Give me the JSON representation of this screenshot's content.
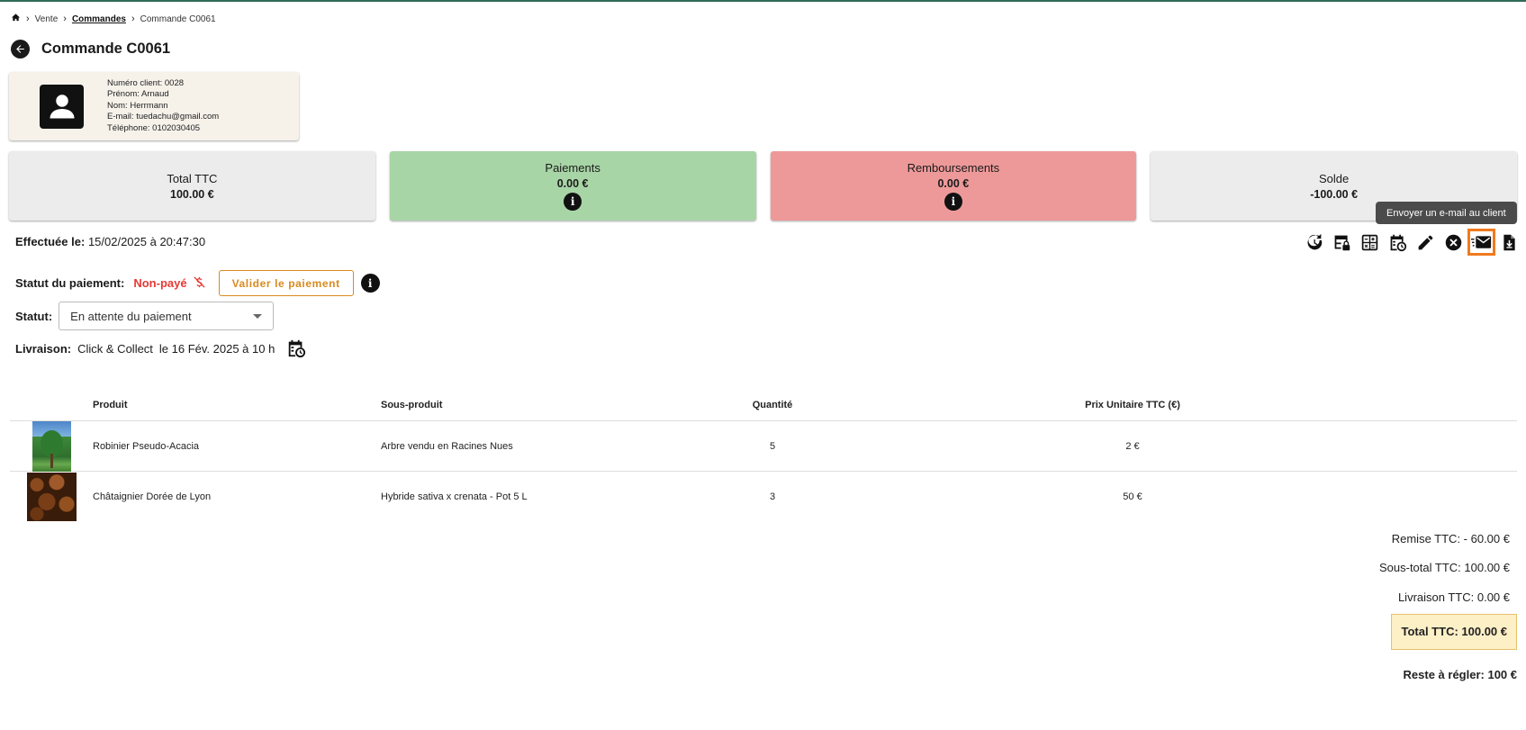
{
  "breadcrumb": {
    "vente": "Vente",
    "commandes": "Commandes",
    "current": "Commande C0061"
  },
  "page": {
    "title": "Commande C0061"
  },
  "client": {
    "numero": "Numéro client: 0028",
    "prenom": "Prénom: Arnaud",
    "nom": "Nom: Herrmann",
    "email": "E-mail: tuedachu@gmail.com",
    "telephone": "Téléphone: 0102030405"
  },
  "stats": {
    "total_label": "Total TTC",
    "total_value": "100.00 €",
    "paiements_label": "Paiements",
    "paiements_value": "0.00 €",
    "remb_label": "Remboursements",
    "remb_value": "0.00 €",
    "solde_label": "Solde",
    "solde_value": "-100.00 €",
    "info_glyph": "i"
  },
  "tooltip": "Envoyer un e-mail au client",
  "order": {
    "done_label": "Effectuée le:",
    "done_value": "15/02/2025 à 20:47:30",
    "payment_status_label": "Statut du paiement:",
    "payment_status_value": "Non-payé",
    "validate_button": "Valider le paiement",
    "status_label": "Statut:",
    "status_value": "En attente du paiement",
    "livraison_label": "Livraison:",
    "livraison_mode": "Click & Collect",
    "livraison_date": "le 16 Fév. 2025 à 10 h"
  },
  "table": {
    "headers": {
      "produit": "Produit",
      "sous_produit": "Sous-produit",
      "quantite": "Quantité",
      "prix": "Prix Unitaire TTC (€)"
    },
    "rows": [
      {
        "produit": "Robinier Pseudo-Acacia",
        "sous_produit": "Arbre vendu en Racines Nues",
        "quantite": "5",
        "prix": "2 €"
      },
      {
        "produit": "Châtaignier Dorée de Lyon",
        "sous_produit": "Hybride sativa x crenata - Pot 5 L",
        "quantite": "3",
        "prix": "50 €"
      }
    ]
  },
  "totals": {
    "remise": "Remise TTC: - 60.00 €",
    "sous_total": "Sous-total TTC: 100.00 €",
    "livraison": "Livraison TTC: 0.00 €",
    "total": "Total TTC: 100.00 €",
    "reste": "Reste à régler: 100 €"
  },
  "colors": {
    "accent_orange": "#f07a1e",
    "nonpaye_red": "#e53935",
    "paiements_green": "#a8d5a6",
    "remb_red": "#ee9999"
  },
  "icons": [
    "home-icon",
    "back-arrow-icon",
    "person-icon",
    "history-icon",
    "table-lock-icon",
    "calculator-icon",
    "calendar-clock-icon",
    "pencil-icon",
    "cancel-icon",
    "email-icon",
    "file-download-icon",
    "no-money-icon",
    "info-icon"
  ]
}
